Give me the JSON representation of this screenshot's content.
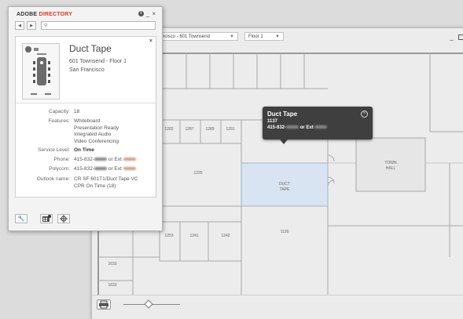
{
  "map_window": {
    "location_dropdown": "ncisco - 601 Townsend",
    "floor_dropdown": "Floor 1",
    "rooms": {
      "r1283": "1283",
      "r1287": "1287",
      "r1289": "1289",
      "r1291": "1291",
      "r1229": "1229",
      "duct_tape": "DUCT\nTAPE",
      "town_hall": "TOWN\nHALL",
      "r1130": "1130",
      "r1253": "1253",
      "r1241": "1241",
      "r1242": "1242",
      "r1633": "1633",
      "r1633b": "1633"
    },
    "tooltip": {
      "title": "Duct Tape",
      "number": "1137",
      "phone_prefix": "415-832-",
      "phone_mid": "or Ext"
    }
  },
  "directory": {
    "brand_1": "ADOBE ",
    "brand_2": "DIRECTORY",
    "room": {
      "name": "Duct Tape",
      "address_line1": "601 Townsend - Floor 1",
      "address_line2": "San Francisco"
    },
    "details": {
      "capacity_label": "Capacity:",
      "capacity": "18",
      "features_label": "Features:",
      "features": [
        "Whiteboard",
        "Presentation Ready",
        "Integrated Audio",
        "Video Conferencing"
      ],
      "service_label": "Service Level:",
      "service": "On Time",
      "phone_label": "Phone:",
      "phone_prefix": "415-832-",
      "phone_mid": "or Ext",
      "polycom_label": "Polycom:",
      "polycom_prefix": "415-832-",
      "polycom_mid": "or Ext",
      "outlook_label": "Outlook name:",
      "outlook_line1": "CR SF 601T1/Duct Tape VC",
      "outlook_line2": "CPR On Time (18)"
    }
  },
  "colors": {
    "brand_red": "#e03a1e",
    "selected_room": "#d8e4f1",
    "tooltip_bg": "#3f3f3f"
  }
}
